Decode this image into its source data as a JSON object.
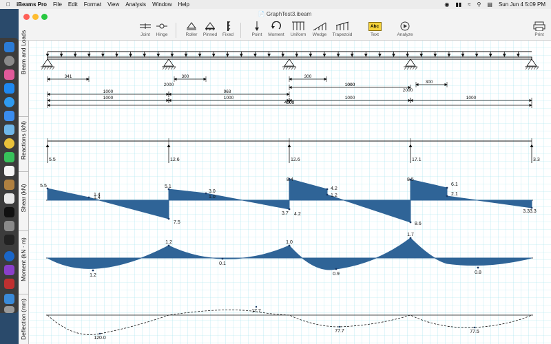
{
  "menubar": {
    "items": [
      "iBeams Pro",
      "File",
      "Edit",
      "Format",
      "View",
      "Analysis",
      "Window",
      "Help"
    ],
    "clock": "Sun Jun 4  5:09 PM"
  },
  "window": {
    "title": "GraphTest3.ibeam",
    "tools": [
      {
        "label": "Joint",
        "icon": "joint-icon"
      },
      {
        "label": "Hinge",
        "icon": "hinge-icon"
      },
      {
        "label": "Roller",
        "icon": "roller-icon"
      },
      {
        "label": "Pinned",
        "icon": "pinned-icon"
      },
      {
        "label": "Fixed",
        "icon": "fixed-icon"
      },
      {
        "label": "Point",
        "icon": "point-load-icon"
      },
      {
        "label": "Moment",
        "icon": "moment-icon"
      },
      {
        "label": "Uniform",
        "icon": "uniform-load-icon"
      },
      {
        "label": "Wedge",
        "icon": "wedge-load-icon"
      },
      {
        "label": "Trapezoid",
        "icon": "trapezoid-load-icon"
      },
      {
        "label": "Text",
        "icon": "text-icon",
        "badge": "Abc"
      },
      {
        "label": "Analyze",
        "icon": "analyze-icon"
      },
      {
        "label": "Print",
        "icon": "print-icon"
      }
    ]
  },
  "sidebar": {
    "beam": "Beam and Loads",
    "reactions": "Reactions (kN)",
    "shear": "Shear (kN)",
    "moment": "Moment (kN · m)",
    "deflection": "Deflection (mm)"
  },
  "dims": {
    "row1": [
      "341",
      "2000",
      "300",
      "300",
      "1000",
      "2000",
      "300"
    ],
    "row2": [
      "1000",
      "968",
      "1000"
    ],
    "row3": [
      "1000",
      "1000",
      "1000",
      "1000"
    ],
    "total": "4000"
  },
  "reactions": [
    "5.5",
    "12.6",
    "12.6",
    "17.1",
    "3.3"
  ],
  "shear_labels": [
    "5.5",
    "1.4",
    "1.4",
    "5.1",
    "3.0",
    "1.0",
    "7.5",
    "8.4",
    "4.2",
    "1.2",
    "3.7",
    "4.2",
    "8.5",
    "6.1",
    "2.1",
    "8.6",
    "3.33.3"
  ],
  "moment_labels": [
    "1.2",
    "1.2",
    "0.1",
    "1.0",
    "0.9",
    "1.7",
    "0.8"
  ],
  "deflection_labels": [
    "120.0",
    "17.7",
    "77.7",
    "77.5"
  ],
  "colors": {
    "grid": "#9fe3ee",
    "fill": "#2f6497",
    "toolbar": "#f3f3f3"
  }
}
